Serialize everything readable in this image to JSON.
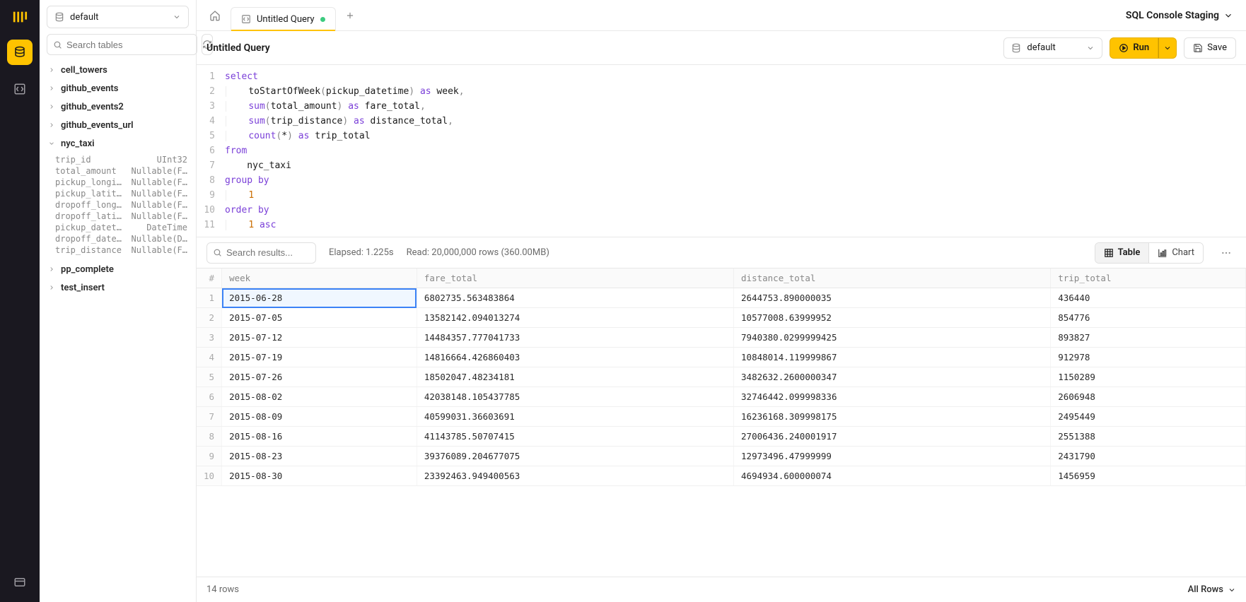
{
  "env_label": "SQL Console Staging",
  "rail": {
    "active": "tables"
  },
  "sidebar": {
    "db_selected": "default",
    "search_placeholder": "Search tables",
    "tables": [
      {
        "name": "cell_towers",
        "expanded": false
      },
      {
        "name": "github_events",
        "expanded": false
      },
      {
        "name": "github_events2",
        "expanded": false
      },
      {
        "name": "github_events_url",
        "expanded": false
      },
      {
        "name": "nyc_taxi",
        "expanded": true,
        "columns": [
          {
            "name": "trip_id",
            "type": "UInt32"
          },
          {
            "name": "total_amount",
            "type": "Nullable(F…"
          },
          {
            "name": "pickup_longi…",
            "type": "Nullable(F…"
          },
          {
            "name": "pickup_latit…",
            "type": "Nullable(F…"
          },
          {
            "name": "dropoff_long…",
            "type": "Nullable(F…"
          },
          {
            "name": "dropoff_lati…",
            "type": "Nullable(F…"
          },
          {
            "name": "pickup_datetime",
            "type": "DateTime"
          },
          {
            "name": "dropoff_date…",
            "type": "Nullable(D…"
          },
          {
            "name": "trip_distance",
            "type": "Nullable(F…"
          }
        ]
      },
      {
        "name": "pp_complete",
        "expanded": false
      },
      {
        "name": "test_insert",
        "expanded": false
      }
    ]
  },
  "tabs": {
    "active_index": 0,
    "items": [
      {
        "label": "Untitled Query",
        "dirty": true
      }
    ]
  },
  "query": {
    "title": "Untitled Query",
    "db_selected": "default",
    "run_label": "Run",
    "save_label": "Save",
    "lines": [
      [
        {
          "t": "select",
          "c": "kw"
        }
      ],
      [
        {
          "t": "    ",
          "c": ""
        },
        {
          "t": "toStartOfWeek",
          "c": "fn"
        },
        {
          "t": "(",
          "c": "paren"
        },
        {
          "t": "pickup_datetime",
          "c": "ident"
        },
        {
          "t": ")",
          "c": "paren"
        },
        {
          "t": " ",
          "c": ""
        },
        {
          "t": "as",
          "c": "kw"
        },
        {
          "t": " week",
          "c": "ident"
        },
        {
          "t": ",",
          "c": "comma"
        }
      ],
      [
        {
          "t": "    ",
          "c": ""
        },
        {
          "t": "sum",
          "c": "kw"
        },
        {
          "t": "(",
          "c": "paren"
        },
        {
          "t": "total_amount",
          "c": "ident"
        },
        {
          "t": ")",
          "c": "paren"
        },
        {
          "t": " ",
          "c": ""
        },
        {
          "t": "as",
          "c": "kw"
        },
        {
          "t": " fare_total",
          "c": "ident"
        },
        {
          "t": ",",
          "c": "comma"
        }
      ],
      [
        {
          "t": "    ",
          "c": ""
        },
        {
          "t": "sum",
          "c": "kw"
        },
        {
          "t": "(",
          "c": "paren"
        },
        {
          "t": "trip_distance",
          "c": "ident"
        },
        {
          "t": ")",
          "c": "paren"
        },
        {
          "t": " ",
          "c": ""
        },
        {
          "t": "as",
          "c": "kw"
        },
        {
          "t": " distance_total",
          "c": "ident"
        },
        {
          "t": ",",
          "c": "comma"
        }
      ],
      [
        {
          "t": "    ",
          "c": ""
        },
        {
          "t": "count",
          "c": "kw"
        },
        {
          "t": "(",
          "c": "paren"
        },
        {
          "t": "*",
          "c": "ident"
        },
        {
          "t": ")",
          "c": "paren"
        },
        {
          "t": " ",
          "c": ""
        },
        {
          "t": "as",
          "c": "kw"
        },
        {
          "t": " trip_total",
          "c": "ident"
        }
      ],
      [
        {
          "t": "from",
          "c": "kw"
        }
      ],
      [
        {
          "t": "    nyc_taxi",
          "c": "ident"
        }
      ],
      [
        {
          "t": "group by",
          "c": "kw"
        }
      ],
      [
        {
          "t": "    ",
          "c": ""
        },
        {
          "t": "1",
          "c": "num"
        }
      ],
      [
        {
          "t": "order by",
          "c": "kw"
        }
      ],
      [
        {
          "t": "    ",
          "c": ""
        },
        {
          "t": "1",
          "c": "num"
        },
        {
          "t": " ",
          "c": ""
        },
        {
          "t": "asc",
          "c": "kw"
        }
      ]
    ]
  },
  "results": {
    "search_placeholder": "Search results...",
    "elapsed": "Elapsed: 1.225s",
    "read": "Read: 20,000,000 rows (360.00MB)",
    "view_table": "Table",
    "view_chart": "Chart",
    "columns": [
      "#",
      "week",
      "fare_total",
      "distance_total",
      "trip_total"
    ],
    "rows": [
      [
        "1",
        "2015-06-28",
        "6802735.563483864",
        "2644753.890000035",
        "436440"
      ],
      [
        "2",
        "2015-07-05",
        "13582142.094013274",
        "10577008.63999952",
        "854776"
      ],
      [
        "3",
        "2015-07-12",
        "14484357.777041733",
        "7940380.0299999425",
        "893827"
      ],
      [
        "4",
        "2015-07-19",
        "14816664.426860403",
        "10848014.119999867",
        "912978"
      ],
      [
        "5",
        "2015-07-26",
        "18502047.48234181",
        "3482632.2600000347",
        "1150289"
      ],
      [
        "6",
        "2015-08-02",
        "42038148.105437785",
        "32746442.099998336",
        "2606948"
      ],
      [
        "7",
        "2015-08-09",
        "40599031.36603691",
        "16236168.309998175",
        "2495449"
      ],
      [
        "8",
        "2015-08-16",
        "41143785.50707415",
        "27006436.240001917",
        "2551388"
      ],
      [
        "9",
        "2015-08-23",
        "39376089.204677075",
        "12973496.47999999",
        "2431790"
      ],
      [
        "10",
        "2015-08-30",
        "23392463.949400563",
        "4694934.600000074",
        "1456959"
      ]
    ],
    "selected_cell": {
      "row": 0,
      "col": 1
    },
    "footer_rows": "14 rows",
    "footer_allrows": "All Rows"
  }
}
